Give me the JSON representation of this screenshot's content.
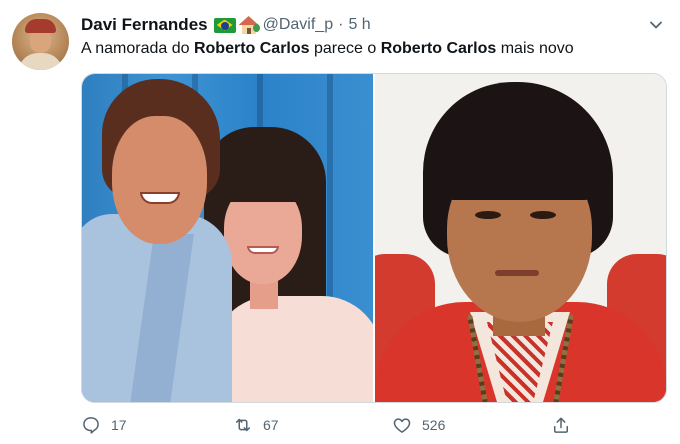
{
  "author": {
    "name": "Davi Fernandes",
    "handle": "@Davif_p",
    "separator": "·",
    "time": "5 h",
    "badges": [
      "brazil-flag-emoji",
      "house-with-garden-emoji"
    ]
  },
  "tweet": {
    "parts": [
      {
        "text": "A namorada do ",
        "bold": false
      },
      {
        "text": "Roberto Carlos",
        "bold": true
      },
      {
        "text": " parece o ",
        "bold": false
      },
      {
        "text": "Roberto Carlos",
        "bold": true
      },
      {
        "text": " mais novo",
        "bold": false
      }
    ]
  },
  "media": {
    "photos": [
      {
        "name": "photo-left",
        "description_icon": "couple-photo"
      },
      {
        "name": "photo-right",
        "description_icon": "vintage-portrait-photo"
      }
    ]
  },
  "actions": {
    "reply_count": "17",
    "retweet_count": "67",
    "like_count": "526",
    "share_label": ""
  },
  "colors": {
    "text_primary": "#0f1419",
    "text_secondary": "#536471",
    "border": "#cfd9de"
  }
}
